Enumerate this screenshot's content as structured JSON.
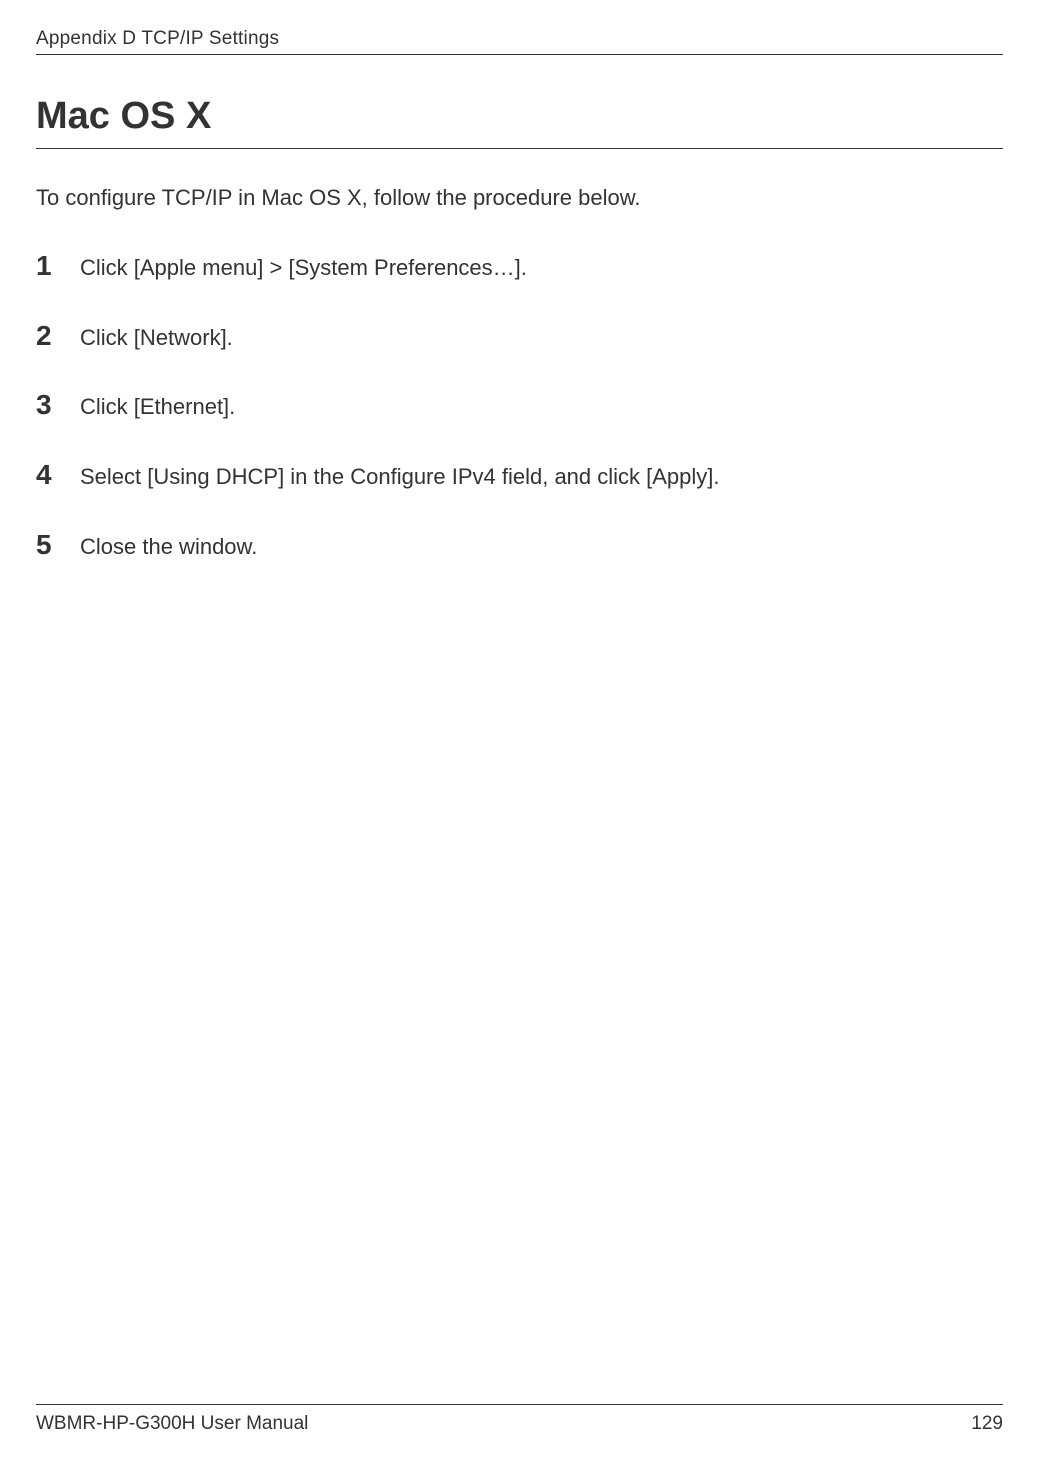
{
  "header": {
    "text": "Appendix D  TCP/IP Settings"
  },
  "title": "Mac OS X",
  "intro": "To configure TCP/IP in Mac OS X, follow the procedure below.",
  "steps": [
    {
      "number": "1",
      "text": "Click [Apple menu] > [System Preferences…]."
    },
    {
      "number": "2",
      "text": "Click [Network]."
    },
    {
      "number": "3",
      "text": "Click [Ethernet]."
    },
    {
      "number": "4",
      "text": "Select [Using DHCP] in the Configure IPv4 field, and click [Apply]."
    },
    {
      "number": "5",
      "text": "Close the window."
    }
  ],
  "footer": {
    "left": "WBMR-HP-G300H User Manual",
    "right": "129"
  }
}
